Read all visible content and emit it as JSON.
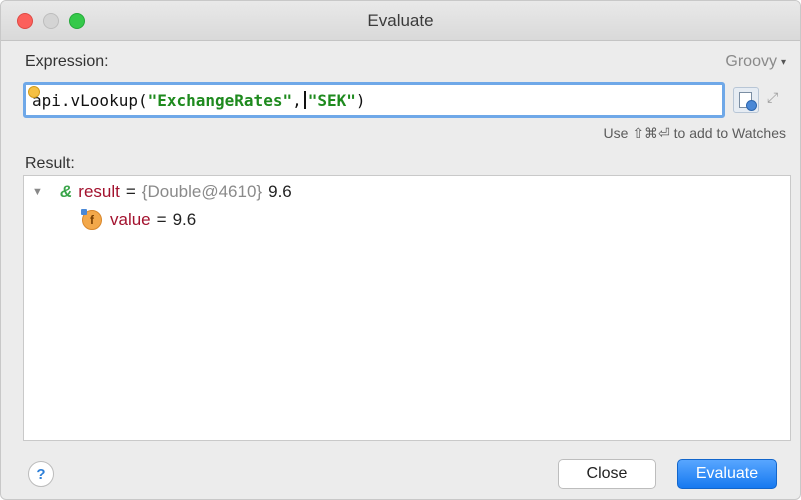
{
  "window": {
    "title": "Evaluate"
  },
  "expression": {
    "label": "Expression:",
    "language": "Groovy",
    "code": {
      "prefix": "api.vLookup(",
      "arg1": "\"ExchangeRates\"",
      "comma": ",",
      "space": " ",
      "arg2": "\"SEK\"",
      "suffix": ")"
    },
    "watches_hint": "Use ⇧⌘⏎ to add to Watches"
  },
  "result": {
    "label": "Result:",
    "rows": [
      {
        "name": "result",
        "eq": "=",
        "type": "{Double@4610}",
        "value": "9.6"
      },
      {
        "name": "value",
        "eq": "=",
        "value": "9.6"
      }
    ]
  },
  "footer": {
    "help": "?",
    "close_label": "Close",
    "evaluate_label": "Evaluate"
  },
  "colors": {
    "accent": "#1679f0",
    "field_border": "#6fa8e8",
    "var_name": "#a3122e",
    "string_literal": "#1e8a1e"
  }
}
